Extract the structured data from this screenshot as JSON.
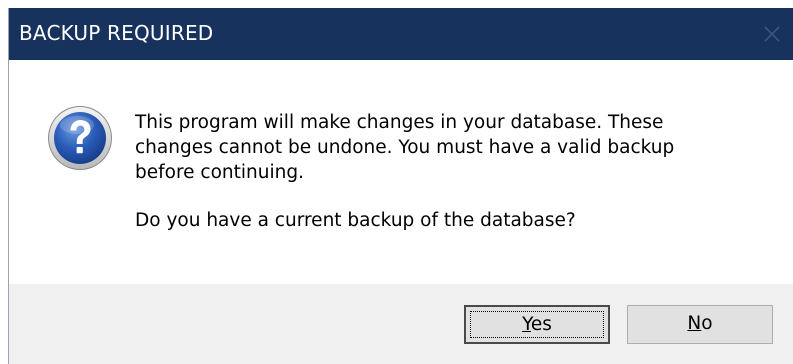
{
  "window": {
    "title": "BACKUP REQUIRED",
    "close_icon": "close-icon"
  },
  "message": {
    "icon": "question-icon",
    "paragraph_1": "This program will make changes in your database.  These\nchanges cannot be undone.  You must have a valid backup\nbefore continuing.",
    "paragraph_2": "Do you have a current backup of the database?"
  },
  "buttons": {
    "yes": {
      "mnemonic": "Y",
      "rest": "es"
    },
    "no": {
      "mnemonic": "N",
      "rest": "o"
    }
  },
  "colors": {
    "titlebar": "#18325e",
    "title_text": "#ffffff",
    "content_bg": "#ffffff",
    "footer_bg": "#f0f0f0",
    "button_bg": "#e1e1e1",
    "icon_blue": "#1d4fa8"
  }
}
